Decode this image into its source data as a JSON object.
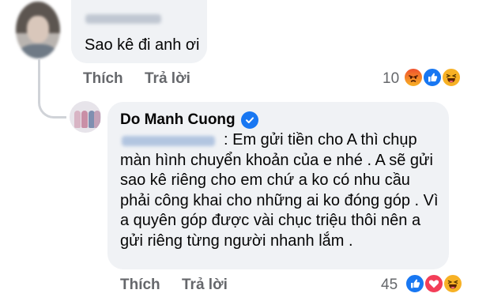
{
  "comment": {
    "text": "Sao kê đi anh ơi",
    "like_label": "Thích",
    "reply_label": "Trả lời",
    "reaction_count": "10",
    "reactions": [
      "angry-icon",
      "like-icon",
      "haha-icon"
    ]
  },
  "reply": {
    "author": "Do Manh Cuong",
    "verified": true,
    "text": ": Em gửi tiền cho A thì chụp màn hình chuyển khoản của e nhé . A sẽ gửi sao kê riêng cho em chứ a ko có nhu cầu phải công khai cho những ai ko đóng góp . Vì a quyên góp được vài chục triệu thôi nên a gửi riêng từng người nhanh lắm .",
    "like_label": "Thích",
    "reply_label": "Trả lời",
    "reaction_count": "45",
    "reactions": [
      "like-icon",
      "love-icon",
      "haha-icon"
    ]
  },
  "colors": {
    "bubble": "#f0f2f5",
    "action_text": "#65676b",
    "like_blue": "#1877f2",
    "love_red": "#f33e58",
    "haha_yellow": "#f7b125"
  }
}
